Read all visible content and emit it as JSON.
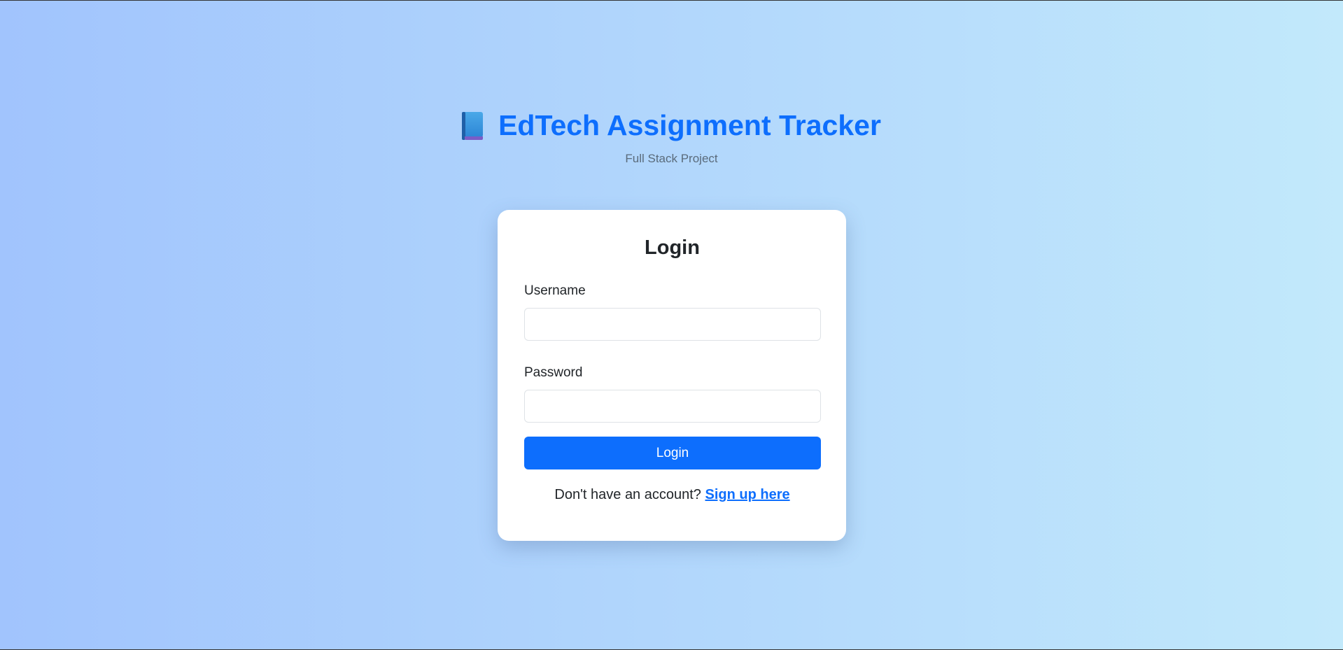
{
  "header": {
    "icon": "book-icon",
    "title": "EdTech Assignment Tracker",
    "subtitle": "Full Stack Project"
  },
  "login": {
    "title": "Login",
    "username_label": "Username",
    "username_value": "",
    "password_label": "Password",
    "password_value": "",
    "submit_label": "Login",
    "signup_prompt": "Don't have an account?",
    "signup_link": "Sign up here"
  },
  "colors": {
    "accent": "#0d6efd",
    "background_start": "#a1c4fd",
    "background_end": "#c2e9fb",
    "card": "#ffffff"
  }
}
